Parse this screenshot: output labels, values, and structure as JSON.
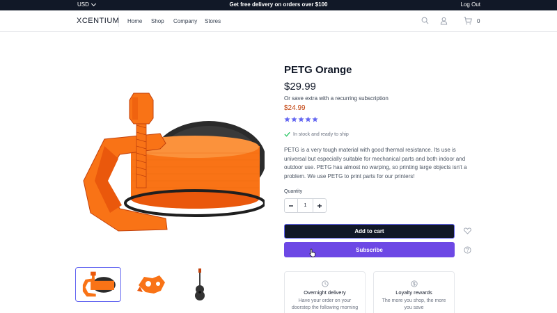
{
  "topbar": {
    "currency": "USD",
    "promo": "Get free delivery on orders over $100",
    "logout": "Log Out"
  },
  "header": {
    "logo": "XCENTIUM",
    "nav": [
      "Home",
      "Shop",
      "Company",
      "Stores"
    ],
    "cart_count": "0"
  },
  "product": {
    "title": "PETG Orange",
    "price": "$29.99",
    "subscription_note": "Or save extra with a recurring subscription",
    "subscription_price": "$24.99",
    "rating": 5,
    "rating_max": 5,
    "stock": "In stock and ready to ship",
    "description": "PETG is a very tough material with good thermal resistance. Its use is universal but especially suitable for mechanical parts and both indoor and outdoor use. PETG has almost no warping, so printing large objects isn't a problem. We use PETG to print parts for our printers!",
    "quantity_label": "Quantity",
    "quantity_value": "1",
    "add_to_cart": "Add to cart",
    "subscribe": "Subscribe"
  },
  "cards": [
    {
      "title": "Overnight delivery",
      "desc": "Have your order on your doorstep the following morning",
      "icon": "clock-icon"
    },
    {
      "title": "Loyalty rewards",
      "desc": "The more you shop, the more you save",
      "icon": "dollar-coin-icon"
    }
  ],
  "colors": {
    "dark": "#111827",
    "accent": "#6d48e5",
    "sale": "#c2410c",
    "star": "#6366f1",
    "check": "#22c55e",
    "filament": "#f97316"
  }
}
